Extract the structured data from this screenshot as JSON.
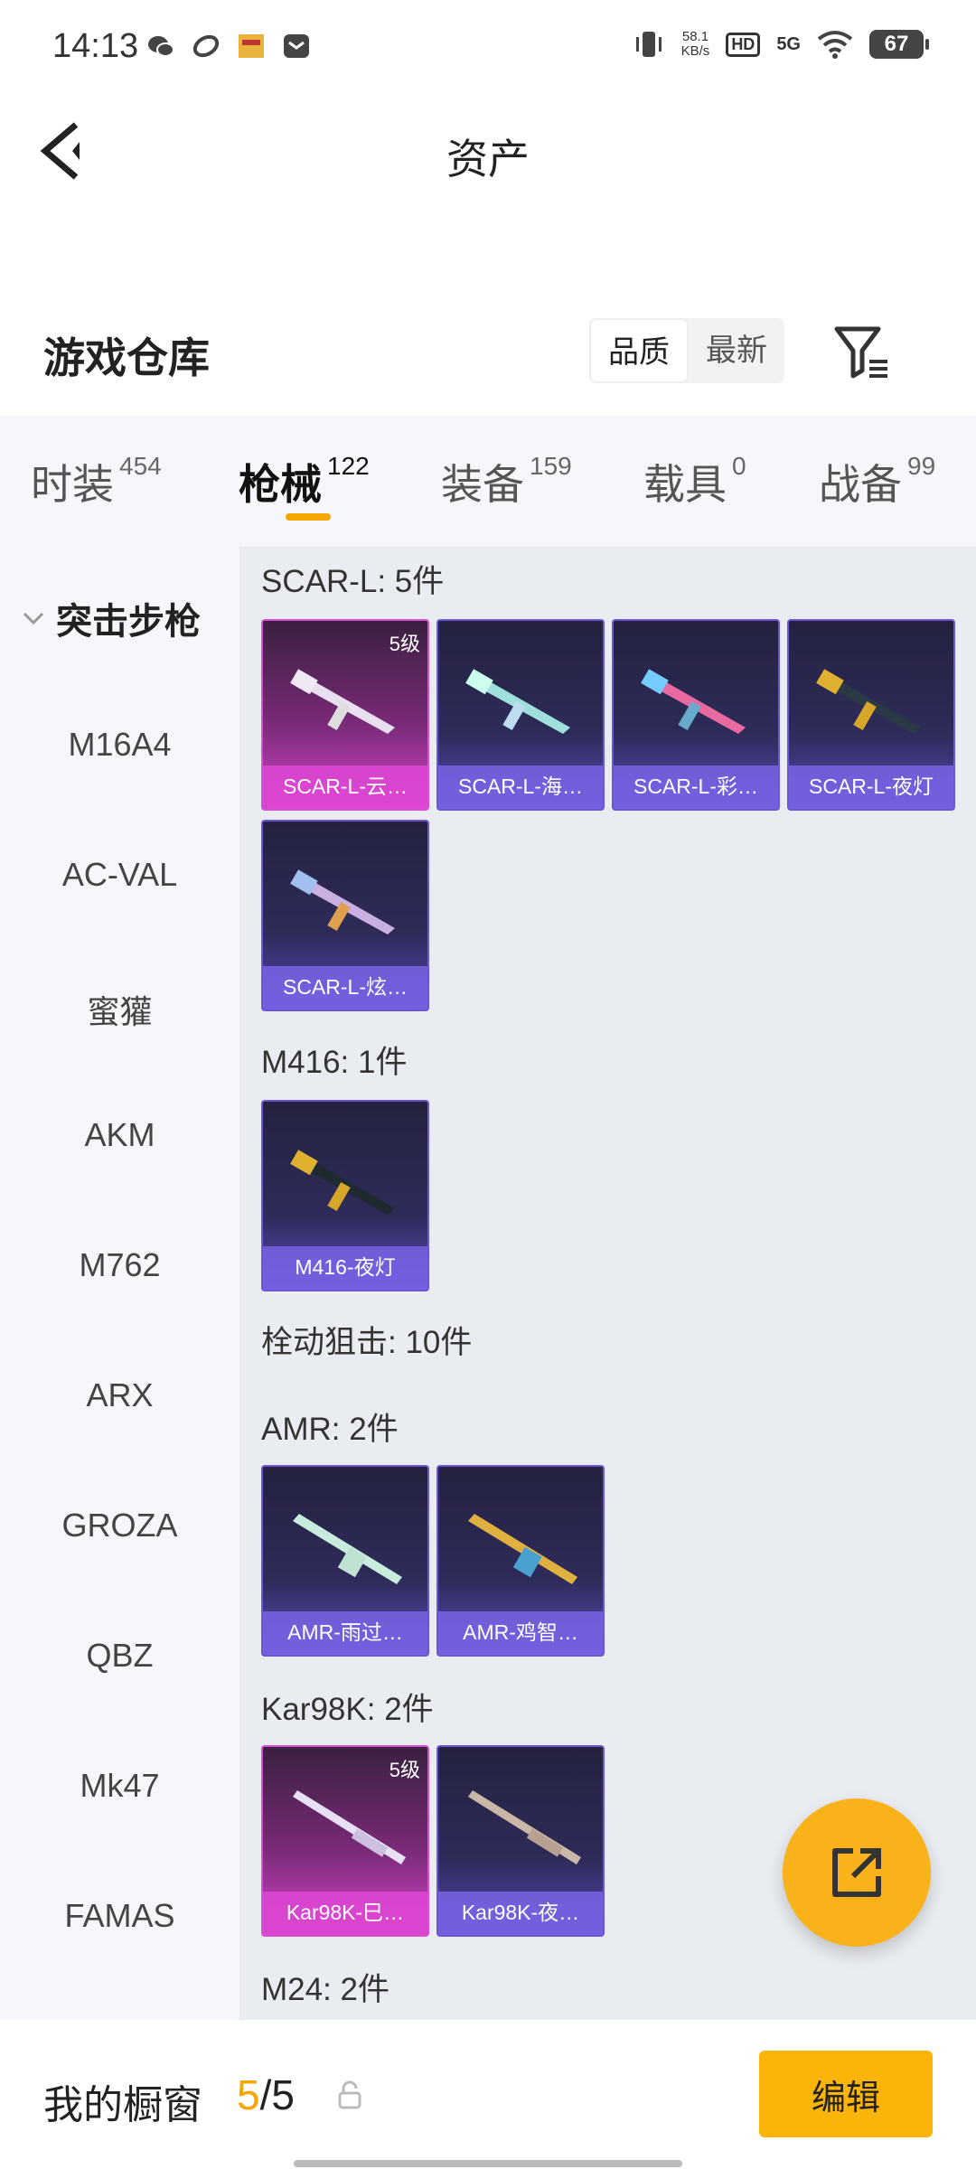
{
  "status_bar": {
    "time": "14:13",
    "net_speed_value": "58.1",
    "net_speed_unit": "KB/s",
    "hd": "HD",
    "signal": "5G",
    "battery": "67"
  },
  "nav": {
    "title": "资产"
  },
  "warehouse": {
    "title": "游戏仓库",
    "sort_options": [
      "品质",
      "最新"
    ],
    "sort_selected": "品质"
  },
  "tabs": [
    {
      "label": "时装",
      "count": "454"
    },
    {
      "label": "枪械",
      "count": "122",
      "active": true
    },
    {
      "label": "装备",
      "count": "159"
    },
    {
      "label": "载具",
      "count": "0"
    },
    {
      "label": "战备",
      "count": "99"
    }
  ],
  "sidebar": {
    "category": "突击步枪",
    "items": [
      "M16A4",
      "AC-VAL",
      "蜜獾",
      "AKM",
      "M762",
      "ARX",
      "GROZA",
      "QBZ",
      "Mk47",
      "FAMAS"
    ]
  },
  "groups": [
    {
      "title": "SCAR-L: 5件",
      "items": [
        {
          "name": "SCAR-L-云…",
          "level": "5级",
          "rarity": "legendary"
        },
        {
          "name": "SCAR-L-海…",
          "rarity": "epic"
        },
        {
          "name": "SCAR-L-彩…",
          "rarity": "epic"
        },
        {
          "name": "SCAR-L-夜灯",
          "rarity": "epic"
        },
        {
          "name": "SCAR-L-炫…",
          "rarity": "epic"
        }
      ]
    },
    {
      "title": "M416: 1件",
      "items": [
        {
          "name": "M416-夜灯",
          "rarity": "epic"
        }
      ]
    },
    {
      "title": "栓动狙击: 10件",
      "items": []
    },
    {
      "title": "AMR: 2件",
      "items": [
        {
          "name": "AMR-雨过…",
          "rarity": "epic"
        },
        {
          "name": "AMR-鸡智…",
          "rarity": "epic"
        }
      ]
    },
    {
      "title": "Kar98K: 2件",
      "items": [
        {
          "name": "Kar98K-巳…",
          "level": "5级",
          "rarity": "legendary"
        },
        {
          "name": "Kar98K-夜…",
          "rarity": "epic"
        }
      ]
    },
    {
      "title": "M24: 2件",
      "items": []
    }
  ],
  "showcase": {
    "label": "我的橱窗",
    "current": "5",
    "total": "5",
    "edit_label": "编辑"
  },
  "colors": {
    "accent": "#f5a600",
    "legendary": "#d84fd4",
    "epic": "#6a56d6"
  },
  "icons": [
    "wechat-icon",
    "app-icon",
    "game-icon",
    "message-icon",
    "vibrate-icon",
    "wifi-icon",
    "back-icon",
    "filter-icon",
    "chevron-down-icon",
    "share-icon",
    "lock-icon"
  ]
}
